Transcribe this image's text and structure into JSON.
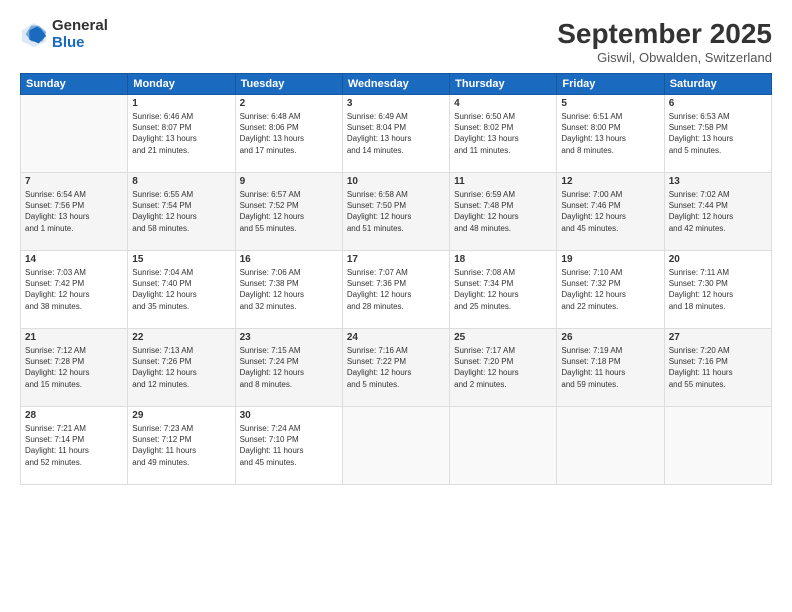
{
  "logo": {
    "general": "General",
    "blue": "Blue"
  },
  "title": "September 2025",
  "subtitle": "Giswil, Obwalden, Switzerland",
  "headers": [
    "Sunday",
    "Monday",
    "Tuesday",
    "Wednesday",
    "Thursday",
    "Friday",
    "Saturday"
  ],
  "weeks": [
    [
      {
        "day": "",
        "info": ""
      },
      {
        "day": "1",
        "info": "Sunrise: 6:46 AM\nSunset: 8:07 PM\nDaylight: 13 hours\nand 21 minutes."
      },
      {
        "day": "2",
        "info": "Sunrise: 6:48 AM\nSunset: 8:06 PM\nDaylight: 13 hours\nand 17 minutes."
      },
      {
        "day": "3",
        "info": "Sunrise: 6:49 AM\nSunset: 8:04 PM\nDaylight: 13 hours\nand 14 minutes."
      },
      {
        "day": "4",
        "info": "Sunrise: 6:50 AM\nSunset: 8:02 PM\nDaylight: 13 hours\nand 11 minutes."
      },
      {
        "day": "5",
        "info": "Sunrise: 6:51 AM\nSunset: 8:00 PM\nDaylight: 13 hours\nand 8 minutes."
      },
      {
        "day": "6",
        "info": "Sunrise: 6:53 AM\nSunset: 7:58 PM\nDaylight: 13 hours\nand 5 minutes."
      }
    ],
    [
      {
        "day": "7",
        "info": "Sunrise: 6:54 AM\nSunset: 7:56 PM\nDaylight: 13 hours\nand 1 minute."
      },
      {
        "day": "8",
        "info": "Sunrise: 6:55 AM\nSunset: 7:54 PM\nDaylight: 12 hours\nand 58 minutes."
      },
      {
        "day": "9",
        "info": "Sunrise: 6:57 AM\nSunset: 7:52 PM\nDaylight: 12 hours\nand 55 minutes."
      },
      {
        "day": "10",
        "info": "Sunrise: 6:58 AM\nSunset: 7:50 PM\nDaylight: 12 hours\nand 51 minutes."
      },
      {
        "day": "11",
        "info": "Sunrise: 6:59 AM\nSunset: 7:48 PM\nDaylight: 12 hours\nand 48 minutes."
      },
      {
        "day": "12",
        "info": "Sunrise: 7:00 AM\nSunset: 7:46 PM\nDaylight: 12 hours\nand 45 minutes."
      },
      {
        "day": "13",
        "info": "Sunrise: 7:02 AM\nSunset: 7:44 PM\nDaylight: 12 hours\nand 42 minutes."
      }
    ],
    [
      {
        "day": "14",
        "info": "Sunrise: 7:03 AM\nSunset: 7:42 PM\nDaylight: 12 hours\nand 38 minutes."
      },
      {
        "day": "15",
        "info": "Sunrise: 7:04 AM\nSunset: 7:40 PM\nDaylight: 12 hours\nand 35 minutes."
      },
      {
        "day": "16",
        "info": "Sunrise: 7:06 AM\nSunset: 7:38 PM\nDaylight: 12 hours\nand 32 minutes."
      },
      {
        "day": "17",
        "info": "Sunrise: 7:07 AM\nSunset: 7:36 PM\nDaylight: 12 hours\nand 28 minutes."
      },
      {
        "day": "18",
        "info": "Sunrise: 7:08 AM\nSunset: 7:34 PM\nDaylight: 12 hours\nand 25 minutes."
      },
      {
        "day": "19",
        "info": "Sunrise: 7:10 AM\nSunset: 7:32 PM\nDaylight: 12 hours\nand 22 minutes."
      },
      {
        "day": "20",
        "info": "Sunrise: 7:11 AM\nSunset: 7:30 PM\nDaylight: 12 hours\nand 18 minutes."
      }
    ],
    [
      {
        "day": "21",
        "info": "Sunrise: 7:12 AM\nSunset: 7:28 PM\nDaylight: 12 hours\nand 15 minutes."
      },
      {
        "day": "22",
        "info": "Sunrise: 7:13 AM\nSunset: 7:26 PM\nDaylight: 12 hours\nand 12 minutes."
      },
      {
        "day": "23",
        "info": "Sunrise: 7:15 AM\nSunset: 7:24 PM\nDaylight: 12 hours\nand 8 minutes."
      },
      {
        "day": "24",
        "info": "Sunrise: 7:16 AM\nSunset: 7:22 PM\nDaylight: 12 hours\nand 5 minutes."
      },
      {
        "day": "25",
        "info": "Sunrise: 7:17 AM\nSunset: 7:20 PM\nDaylight: 12 hours\nand 2 minutes."
      },
      {
        "day": "26",
        "info": "Sunrise: 7:19 AM\nSunset: 7:18 PM\nDaylight: 11 hours\nand 59 minutes."
      },
      {
        "day": "27",
        "info": "Sunrise: 7:20 AM\nSunset: 7:16 PM\nDaylight: 11 hours\nand 55 minutes."
      }
    ],
    [
      {
        "day": "28",
        "info": "Sunrise: 7:21 AM\nSunset: 7:14 PM\nDaylight: 11 hours\nand 52 minutes."
      },
      {
        "day": "29",
        "info": "Sunrise: 7:23 AM\nSunset: 7:12 PM\nDaylight: 11 hours\nand 49 minutes."
      },
      {
        "day": "30",
        "info": "Sunrise: 7:24 AM\nSunset: 7:10 PM\nDaylight: 11 hours\nand 45 minutes."
      },
      {
        "day": "",
        "info": ""
      },
      {
        "day": "",
        "info": ""
      },
      {
        "day": "",
        "info": ""
      },
      {
        "day": "",
        "info": ""
      }
    ]
  ]
}
